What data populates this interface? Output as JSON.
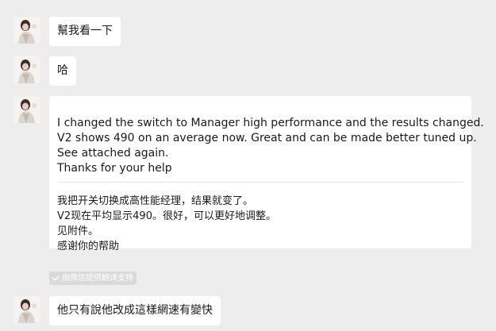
{
  "messages": [
    {
      "avatar_icon": "user-avatar-icon",
      "text": "幫我看一下"
    },
    {
      "avatar_icon": "user-avatar-icon",
      "text": "哈"
    },
    {
      "avatar_icon": "user-avatar-icon",
      "original_lines": [
        "I changed the switch to Manager high performance and the results changed.",
        "V2 shows 490 on an average now. Great and can be made better tuned up.",
        "See attached again.",
        "Thanks for your help"
      ],
      "translation_lines": [
        "我把开关切换成高性能经理，结果就变了。",
        "V2现在平均显示490。很好，可以更好地调整。",
        "见附件。",
        "感谢你的帮助"
      ],
      "translation_badge": "由微信提供翻译支持",
      "badge_icon": "check-icon"
    },
    {
      "avatar_icon": "user-avatar-icon",
      "text": "他只有說他改成這樣網速有變快"
    }
  ],
  "colors": {
    "background": "#ededed",
    "bubble": "#ffffff",
    "badge": "#dadada",
    "text": "#191919"
  }
}
